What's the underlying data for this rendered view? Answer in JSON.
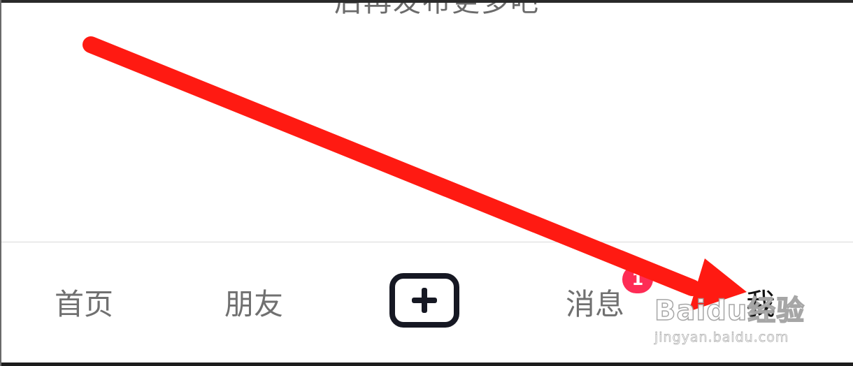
{
  "header": {
    "partial_text": "后再发布更多吧"
  },
  "tabbar": {
    "tabs": [
      {
        "key": "home",
        "label": "首页"
      },
      {
        "key": "friends",
        "label": "朋友"
      },
      {
        "key": "create",
        "label": "",
        "icon": "plus-icon"
      },
      {
        "key": "messages",
        "label": "消息",
        "badge": "1"
      },
      {
        "key": "me",
        "label": "我",
        "active": true
      }
    ]
  },
  "annotation": {
    "color": "#ff1a12",
    "icon": "arrow-icon"
  },
  "watermark": {
    "logo": "Baidu经验",
    "url": "jingyan.baidu.com"
  },
  "colors": {
    "badge": "#fe2c55",
    "plus_border": "#161823",
    "tab_inactive": "#707070",
    "tab_active": "#111111"
  }
}
